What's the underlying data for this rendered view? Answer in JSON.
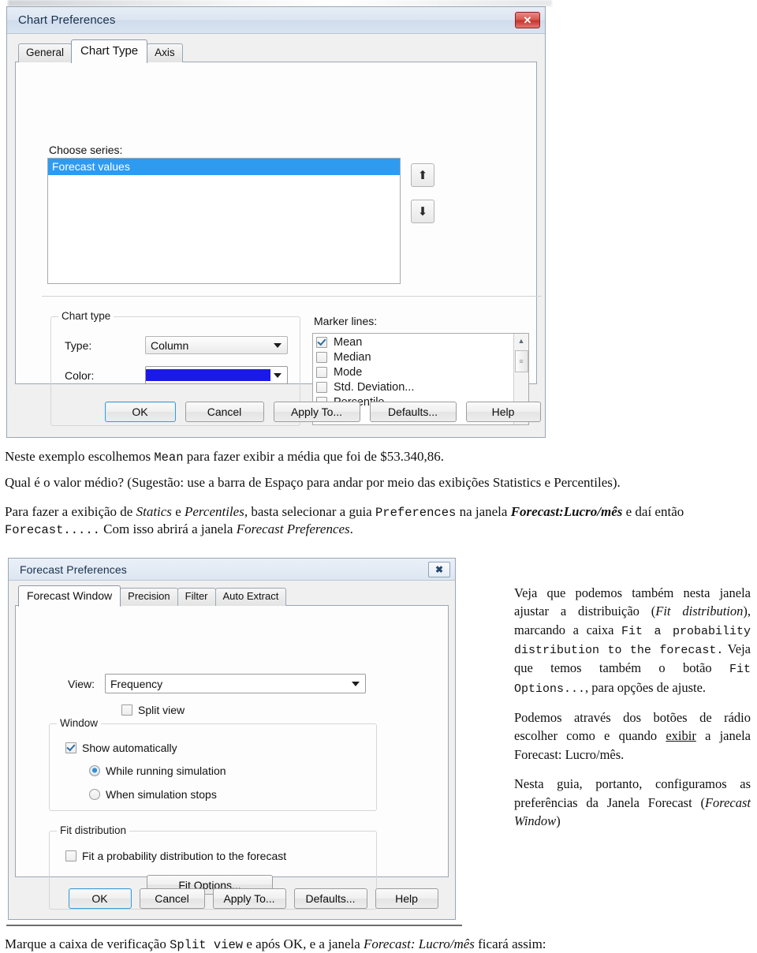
{
  "chart_prefs_dialog": {
    "title": "Chart Preferences",
    "close_label": "✕",
    "tabs": [
      {
        "label": "General",
        "active": false
      },
      {
        "label": "Chart Type",
        "active": true
      },
      {
        "label": "Axis",
        "active": false
      }
    ],
    "choose_series_label": "Choose series:",
    "series_items": [
      "Forecast values"
    ],
    "move_up_icon": "⬆",
    "move_down_icon": "⬇",
    "chart_type_group": {
      "title": "Chart type",
      "type_label": "Type:",
      "type_value": "Column",
      "color_label": "Color:",
      "color_value": "#1a1ae6"
    },
    "marker_lines": {
      "label": "Marker lines:",
      "items": [
        {
          "label": "Mean",
          "checked": true
        },
        {
          "label": "Median",
          "checked": false
        },
        {
          "label": "Mode",
          "checked": false
        },
        {
          "label": "Std. Deviation...",
          "checked": false
        },
        {
          "label": "Percentile...",
          "checked": false
        }
      ],
      "scroll_up_icon": "▲",
      "scroll_down_icon": "▼",
      "thumb_icon": "≡"
    },
    "buttons": [
      "OK",
      "Cancel",
      "Apply To...",
      "Defaults...",
      "Help"
    ]
  },
  "mid_text": {
    "p1_a": "Neste exemplo escolhemos ",
    "p1_mono": "Mean",
    "p1_b": " para fazer exibir a média que foi de $53.340,86.",
    "p2": " Qual é o valor médio? (Sugestão: use a barra de Espaço para andar por meio das exibições Statistics e Percentiles).",
    "p3_a": "Para fazer a exibição de ",
    "p3_i1": "Statics",
    "p3_b": " e ",
    "p3_i2": "Percentiles",
    "p3_c": ", basta selecionar a guia ",
    "p3_mono1": "Preferences",
    "p3_d": " na janela ",
    "p3_i3": "Forecast:Lucro/mês",
    "p3_e": " e daí então ",
    "p3_mono2": "Forecast.....",
    "p3_f": " Com isso abrirá a janela ",
    "p3_i4": "Forecast Preferences",
    "p3_g": "."
  },
  "forecast_prefs_dialog": {
    "title": "Forecast Preferences",
    "close_label": "✖",
    "tabs": [
      {
        "label": "Forecast Window",
        "active": true
      },
      {
        "label": "Precision",
        "active": false
      },
      {
        "label": "Filter",
        "active": false
      },
      {
        "label": "Auto Extract",
        "active": false
      }
    ],
    "view_label": "View:",
    "view_value": "Frequency",
    "split_view": {
      "label": "Split view",
      "checked": false
    },
    "window_group": {
      "title": "Window",
      "show_automatically": {
        "label": "Show automatically",
        "checked": true
      },
      "radios": [
        {
          "label": "While running simulation",
          "selected": true
        },
        {
          "label": "When simulation stops",
          "selected": false
        }
      ]
    },
    "fit_group": {
      "title": "Fit distribution",
      "fit_checkbox": {
        "label": "Fit a probability distribution to the forecast",
        "checked": false
      },
      "fit_options_button": "Fit Options..."
    },
    "buttons": [
      "OK",
      "Cancel",
      "Apply To...",
      "Defaults...",
      "Help"
    ]
  },
  "right_column": {
    "p1_a": "Veja que podemos também nesta janela ajustar a distribuição (",
    "p1_i": "Fit distribution",
    "p1_b": "), marcando a caixa ",
    "p1_mono1": "Fit a probability distribution to the forecast.",
    "p1_c": " Veja que temos também o botão ",
    "p1_mono2": "Fit Options...",
    "p1_d": ", para opções de ajuste.",
    "p2_a": "Podemos através dos botões de rádio escolher como e quando ",
    "p2_u": "exibir",
    "p2_b": " a janela Forecast: Lucro/mês.",
    "p3_a": "Nesta guia, portanto, configuramos as preferências da Janela Forecast (",
    "p3_i": "Forecast Window",
    "p3_b": ")"
  },
  "bottom_text": {
    "a": "Marque a caixa de verificação ",
    "mono": "Split view",
    "b": " e após OK, e a janela ",
    "i": "Forecast: Lucro/mês",
    "c": " ficará assim:"
  }
}
